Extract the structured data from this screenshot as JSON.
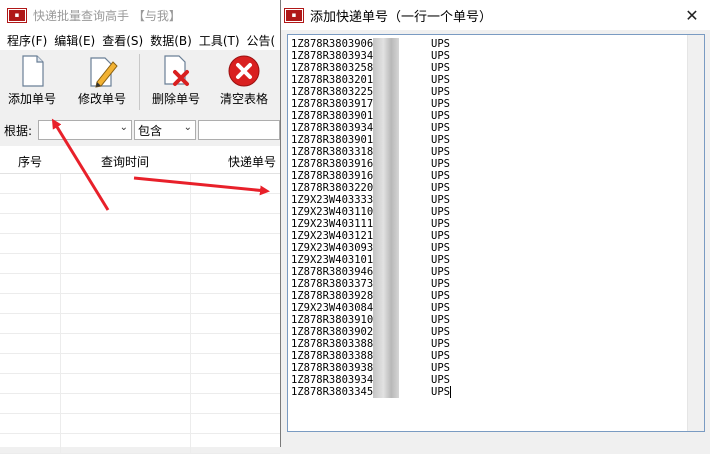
{
  "main_window": {
    "title": "快递批量查询高手 【与我】",
    "menu": [
      "程序(F)",
      "编辑(E)",
      "查看(S)",
      "数据(B)",
      "工具(T)",
      "公告("
    ],
    "toolbar": {
      "add_label": "添加单号",
      "edit_label": "修改单号",
      "delete_label": "删除单号",
      "clear_label": "清空表格"
    },
    "filter": {
      "label": "根据:",
      "field_value": "",
      "op_value": "包含",
      "text_value": ""
    },
    "grid": {
      "columns": [
        "序号",
        "查询时间",
        "快递单号"
      ]
    }
  },
  "dialog": {
    "title": "添加快递单号（一行一个单号）",
    "close_glyph": "✕",
    "entries": [
      {
        "num": "1Z878R38039068",
        "carrier": "UPS"
      },
      {
        "num": "1Z878R38039342",
        "carrier": "UPS"
      },
      {
        "num": "1Z878R38032585",
        "carrier": "UPS"
      },
      {
        "num": "1Z878R38032014",
        "carrier": "UPS"
      },
      {
        "num": "1Z878R38032254",
        "carrier": "UPS"
      },
      {
        "num": "1Z878R38039179",
        "carrier": "UPS"
      },
      {
        "num": "1Z878R38039017",
        "carrier": "UPS"
      },
      {
        "num": "1Z878R38039342",
        "carrier": "UPS"
      },
      {
        "num": "1Z878R38039012",
        "carrier": "UPS"
      },
      {
        "num": "1Z878R38033185",
        "carrier": "UPS"
      },
      {
        "num": "1Z878R38039169",
        "carrier": "UPS"
      },
      {
        "num": "1Z878R38039169",
        "carrier": "UPS"
      },
      {
        "num": "1Z878R38032203",
        "carrier": "UPS"
      },
      {
        "num": "1Z9X23W40333320",
        "carrier": "UPS"
      },
      {
        "num": "1Z9X23W4031102",
        "carrier": "UPS"
      },
      {
        "num": "1Z9X23W40311198",
        "carrier": "UPS"
      },
      {
        "num": "1Z9X23W4031211",
        "carrier": "UPS"
      },
      {
        "num": "1Z9X23W4030932",
        "carrier": "UPS"
      },
      {
        "num": "1Z9X23W4031012",
        "carrier": "UPS"
      },
      {
        "num": "1Z878R38039465",
        "carrier": "UPS"
      },
      {
        "num": "1Z878R38033730",
        "carrier": "UPS"
      },
      {
        "num": "1Z878R38039284",
        "carrier": "UPS"
      },
      {
        "num": "1Z9X23W4030845",
        "carrier": "UPS"
      },
      {
        "num": "1Z878R38039105",
        "carrier": "UPS"
      },
      {
        "num": "1Z878R38039021",
        "carrier": "UPS"
      },
      {
        "num": "1Z878R38033881",
        "carrier": "UPS"
      },
      {
        "num": "1Z878R38033885",
        "carrier": "UPS"
      },
      {
        "num": "1Z878R38039383",
        "carrier": "UPS"
      },
      {
        "num": "1Z878R38039344",
        "carrier": "UPS"
      },
      {
        "num": "1Z878R38033454",
        "carrier": "UPS"
      }
    ]
  },
  "colors": {
    "arrow": "#e8202a",
    "icon_red": "#d92020",
    "selection_border": "#7a9bc2"
  }
}
